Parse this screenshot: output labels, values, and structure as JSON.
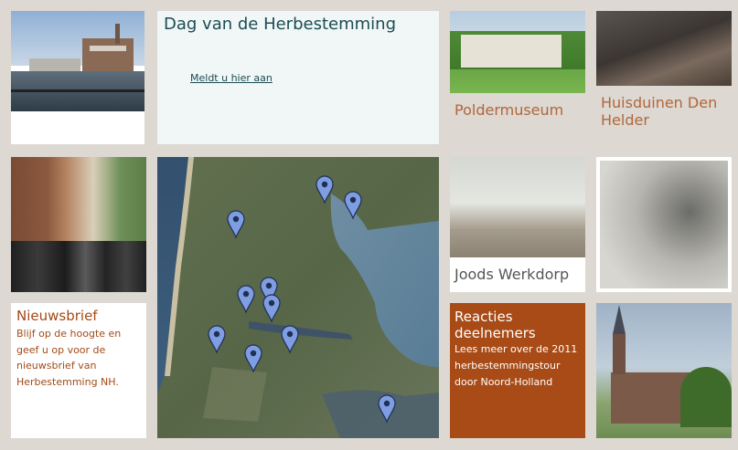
{
  "dag": {
    "title": "Dag van de Herbestemming",
    "link": "Meldt u hier aan"
  },
  "polder": {
    "label": "Poldermuseum"
  },
  "huisduinen": {
    "label": "Huisduinen Den Helder"
  },
  "nieuwsbrief": {
    "title": "Nieuwsbrief",
    "body": "Blijf op de hoogte en geef u op voor de nieuwsbrief van Herbestemming NH."
  },
  "joods": {
    "label": "Joods Werkdorp"
  },
  "reacties": {
    "title": "Reacties deelnemers",
    "body": "Lees meer over de 2011 herbestemmingstour door Noord-Holland"
  },
  "map": {
    "marker_color": "#7f9ee2",
    "marker_count": 11
  },
  "colors": {
    "background": "#ddd8d2",
    "accent": "#a84b17",
    "title_teal": "#1a4d52",
    "label_brown": "#b0673a"
  }
}
